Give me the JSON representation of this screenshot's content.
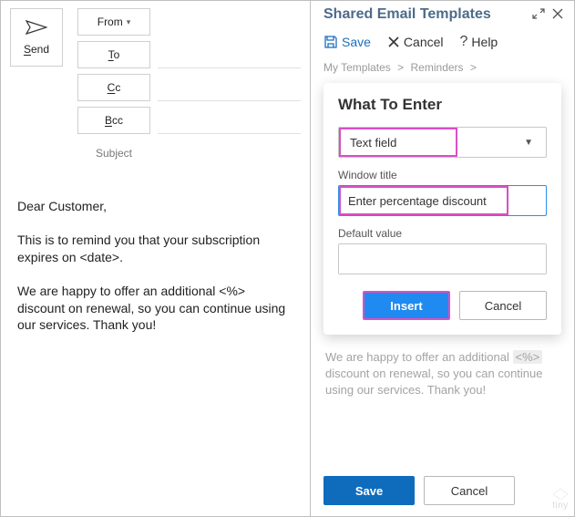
{
  "compose": {
    "send_label": "Send",
    "from_label": "From",
    "to_label": "To",
    "cc_label": "Cc",
    "bcc_label": "Bcc",
    "subject_label": "Subject",
    "body_greeting": "Dear Customer,",
    "body_p1": "This is to remind you that your subscription expires on <date>.",
    "body_p2": "We are happy to offer an additional <%> discount on renewal, so you can continue using our services. Thank you!"
  },
  "pane": {
    "title": "Shared Email Templates",
    "toolbar": {
      "save": "Save",
      "cancel": "Cancel",
      "help": "Help"
    },
    "breadcrumbs": [
      "My Templates",
      "Reminders"
    ],
    "dialog": {
      "title": "What To Enter",
      "type_value": "Text field",
      "window_title_label": "Window title",
      "window_title_value": "Enter percentage discount",
      "default_value_label": "Default value",
      "default_value": "",
      "insert_label": "Insert",
      "cancel_label": "Cancel"
    },
    "preview_pre": "We are happy to offer an additional ",
    "preview_ph": "<%>",
    "preview_post": " discount on renewal, so you can continue using our services. Thank you!",
    "footer": {
      "save": "Save",
      "cancel": "Cancel"
    }
  },
  "watermark": "tiny"
}
